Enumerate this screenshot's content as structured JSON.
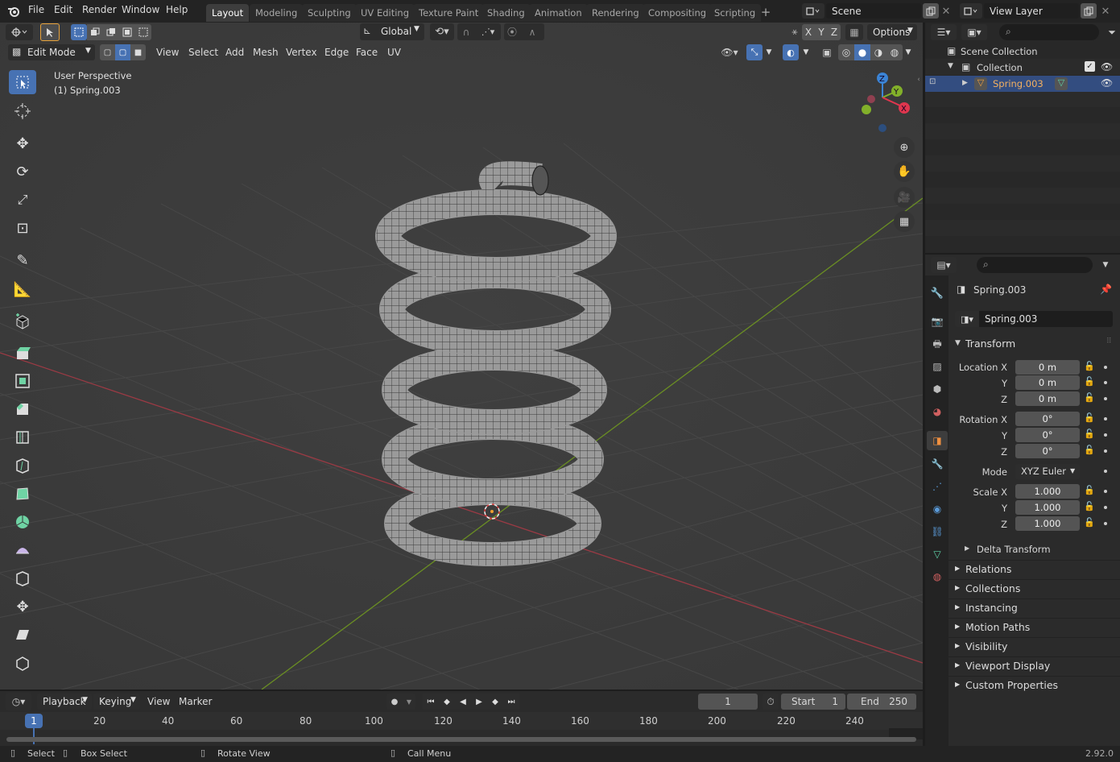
{
  "app": {
    "menus": [
      "File",
      "Edit",
      "Render",
      "Window",
      "Help"
    ]
  },
  "workspaces": [
    "Layout",
    "Modeling",
    "Sculpting",
    "UV Editing",
    "Texture Paint",
    "Shading",
    "Animation",
    "Rendering",
    "Compositing",
    "Scripting"
  ],
  "scene": {
    "label": "Scene",
    "view_layer": "View Layer"
  },
  "header": {
    "orientation": "Global",
    "mode": "Edit Mode",
    "menus": [
      "View",
      "Select",
      "Add",
      "Mesh",
      "Vertex",
      "Edge",
      "Face",
      "UV"
    ],
    "axes": [
      "X",
      "Y",
      "Z"
    ],
    "options": "Options"
  },
  "viewport": {
    "perspective": "User Perspective",
    "object": "(1) Spring.003",
    "gizmo": {
      "x": "X",
      "y": "Y",
      "z": "Z"
    }
  },
  "timeline": {
    "menus": [
      "Playback",
      "Keying",
      "View",
      "Marker"
    ],
    "current_frame": "1",
    "start_label": "Start",
    "start": "1",
    "end_label": "End",
    "end": "250",
    "ticks": [
      "1",
      "20",
      "40",
      "60",
      "80",
      "100",
      "120",
      "140",
      "160",
      "180",
      "200",
      "220",
      "240"
    ]
  },
  "outliner": {
    "items": [
      "Scene Collection",
      "Collection",
      "Spring.003"
    ]
  },
  "properties": {
    "object_name": "Spring.003",
    "data_name": "Spring.003",
    "transform_label": "Transform",
    "location": {
      "label": "Location X",
      "x": "0 m",
      "y": "0 m",
      "z": "0 m"
    },
    "rotation": {
      "label": "Rotation X",
      "x": "0°",
      "y": "0°",
      "z": "0°"
    },
    "mode": {
      "label": "Mode",
      "value": "XYZ Euler"
    },
    "scale": {
      "label": "Scale X",
      "x": "1.000",
      "y": "1.000",
      "z": "1.000"
    },
    "axis_y": "Y",
    "axis_z": "Z",
    "delta": "Delta Transform",
    "panels": [
      "Relations",
      "Collections",
      "Instancing",
      "Motion Paths",
      "Visibility",
      "Viewport Display",
      "Custom Properties"
    ]
  },
  "status": {
    "select": "Select",
    "box_select": "Box Select",
    "rotate": "Rotate View",
    "call_menu": "Call Menu",
    "version": "2.92.0"
  }
}
